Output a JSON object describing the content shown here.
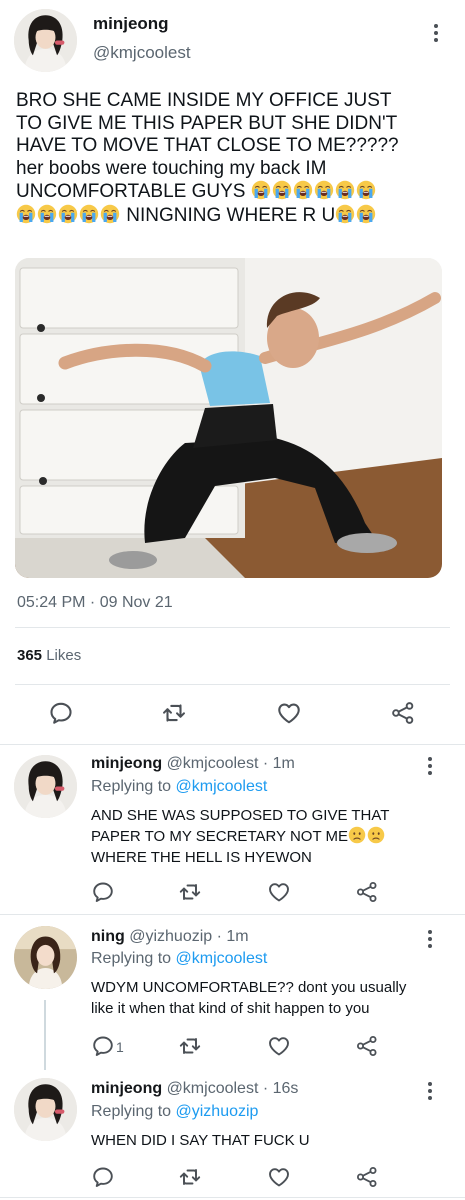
{
  "main_tweet": {
    "display_name": "minjeong",
    "handle": "@kmjcoolest",
    "text_line1": "BRO SHE CAME INSIDE MY OFFICE JUST",
    "text_line2": "TO GIVE ME THIS PAPER BUT SHE DIDN'T",
    "text_line3": "HAVE TO MOVE THAT CLOSE TO ME?????",
    "text_line4": "her boobs were touching my back IM",
    "text_line5": "UNCOMFORTABLE GUYS",
    "text_line6": "NINGNING WHERE R U",
    "timestamp": "05:24 PM · 09 Nov 21",
    "likes_count": "365",
    "likes_label": "Likes"
  },
  "icons": {
    "more": "more-vertical-icon",
    "reply": "reply-bubble-icon",
    "retweet": "retweet-icon",
    "like": "heart-icon",
    "share": "share-icon",
    "crying": "loudly-crying-face-emoji",
    "worried": "slightly-frowning-face-emoji"
  },
  "replies": [
    {
      "display_name": "minjeong",
      "handle_time": "@kmjcoolest · 1m",
      "replying_label": "Replying to",
      "replying_to": "@kmjcoolest",
      "line1": "AND SHE WAS SUPPOSED TO GIVE THAT",
      "line2": "PAPER TO MY SECRETARY NOT ME",
      "line3": "WHERE THE HELL IS HYEWON"
    },
    {
      "display_name": "ning",
      "handle_time": "@yizhuozip · 1m",
      "replying_label": "Replying to",
      "replying_to": "@kmjcoolest",
      "line1": "WDYM UNCOMFORTABLE?? dont you usually",
      "line2": "like it when that kind of shit happen to you",
      "reply_count": "1"
    },
    {
      "display_name": "minjeong",
      "handle_time": "@kmjcoolest · 16s",
      "replying_label": "Replying to",
      "replying_to": "@yizhuozip",
      "line1": "WHEN DID I SAY THAT FUCK U"
    }
  ],
  "colors": {
    "link": "#1d9bf0",
    "secondary_text": "#5b6670",
    "icon": "#4b5056"
  }
}
